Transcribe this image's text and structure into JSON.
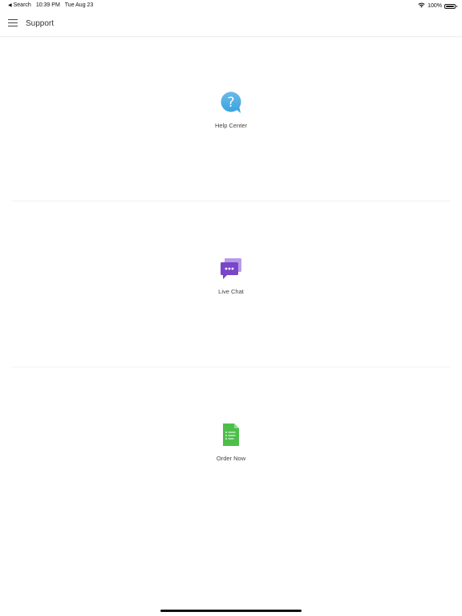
{
  "status_bar": {
    "back_app": "Search",
    "time": "10:39 PM",
    "date": "Tue Aug 23",
    "battery": "100%"
  },
  "header": {
    "title": "Support"
  },
  "options": [
    {
      "label": "Help Center",
      "icon": "help-bubble-icon"
    },
    {
      "label": "Live Chat",
      "icon": "chat-bubbles-icon"
    },
    {
      "label": "Order Now",
      "icon": "document-list-icon"
    }
  ],
  "colors": {
    "help": "#3aa3e0",
    "chat": "#7a46c9",
    "order": "#4cbf4a"
  }
}
